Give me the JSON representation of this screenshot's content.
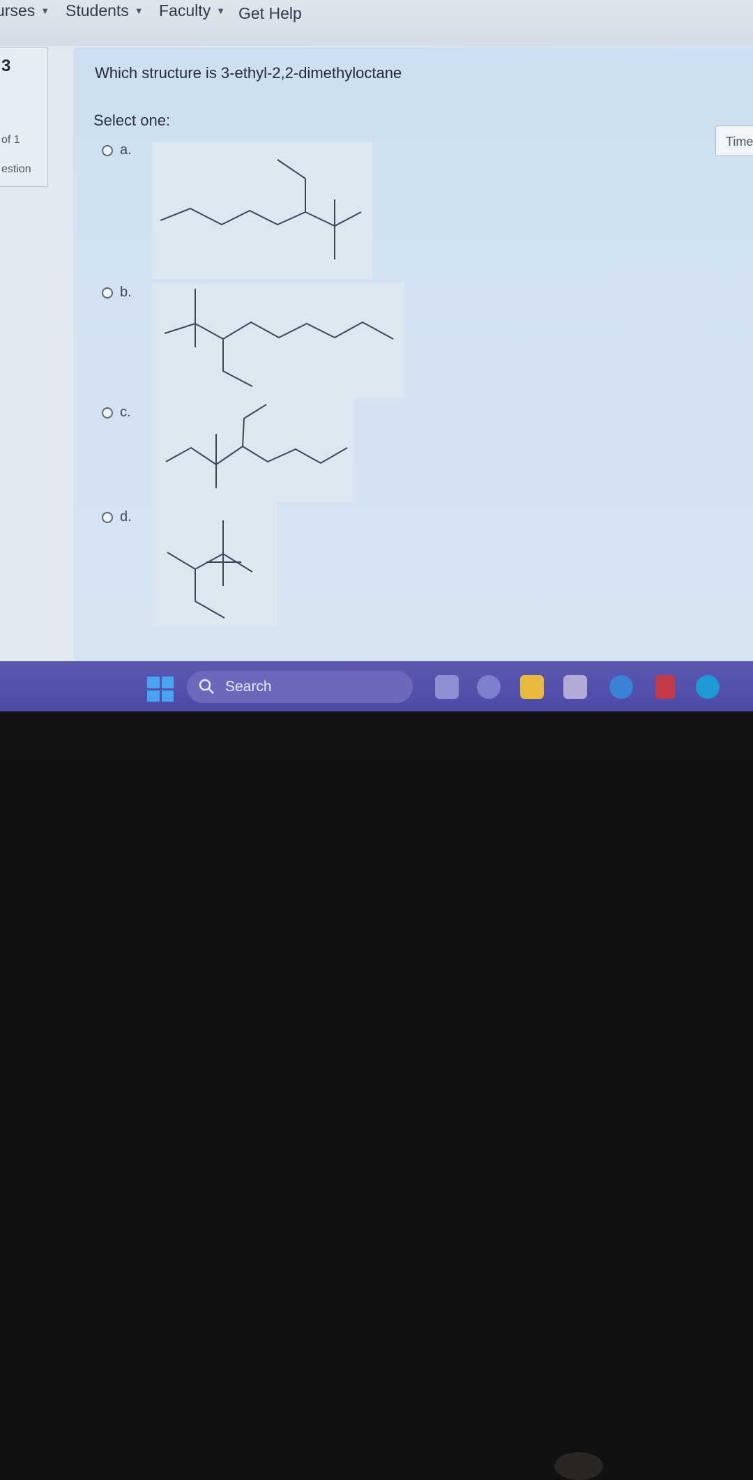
{
  "nav": {
    "items": [
      {
        "label": "urses"
      },
      {
        "label": "Students"
      },
      {
        "label": "Faculty"
      },
      {
        "label": "Get Help"
      }
    ]
  },
  "question_info": {
    "number": "3",
    "of_text": "of 1",
    "question_text": "estion"
  },
  "question": {
    "text": "Which structure is 3-ethyl-2,2-dimethyloctane",
    "prompt": "Select one:",
    "options": [
      {
        "label": "a.",
        "icon": "skeletal-structure-a"
      },
      {
        "label": "b.",
        "icon": "skeletal-structure-b"
      },
      {
        "label": "c.",
        "icon": "skeletal-structure-c"
      },
      {
        "label": "d.",
        "icon": "skeletal-structure-d"
      }
    ]
  },
  "timer": {
    "label": "Time"
  },
  "taskbar": {
    "search_label": "Search",
    "colors": {
      "bar": "#4b4aa6",
      "start": "#4aa3f0"
    },
    "icons": [
      "windows-start-icon",
      "search-icon",
      "file-manager-icon",
      "camera-icon",
      "file-explorer-icon",
      "app-icon",
      "help-icon",
      "mcafee-icon",
      "edge-icon"
    ]
  }
}
